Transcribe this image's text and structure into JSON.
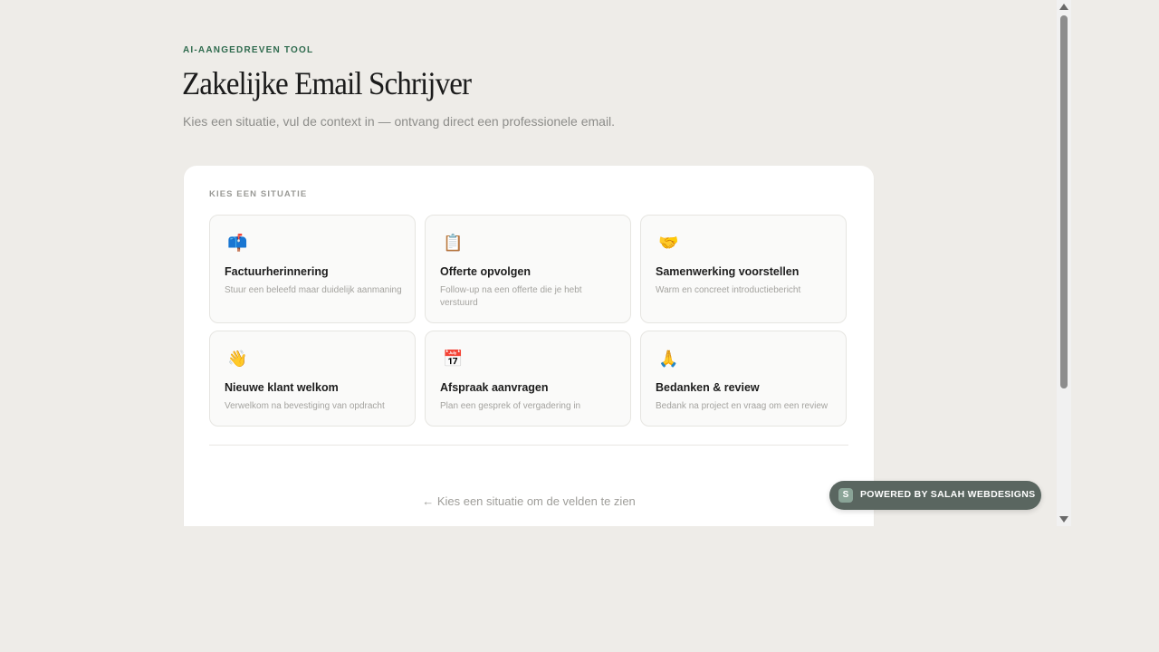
{
  "header": {
    "eyebrow": "AI-AANGEDREVEN TOOL",
    "title": "Zakelijke Email Schrijver",
    "subtitle": "Kies een situatie, vul de context in — ontvang direct een professionele email."
  },
  "panel": {
    "section_label": "KIES EEN SITUATIE",
    "situations": [
      {
        "icon": "mailbox-icon",
        "emoji": "📫",
        "title": "Factuurherinnering",
        "description": "Stuur een beleefd maar duidelijk aanmaning"
      },
      {
        "icon": "clipboard-icon",
        "emoji": "📋",
        "title": "Offerte opvolgen",
        "description": "Follow-up na een offerte die je hebt verstuurd"
      },
      {
        "icon": "handshake-icon",
        "emoji": "🤝",
        "title": "Samenwerking voorstellen",
        "description": "Warm en concreet introductiebericht"
      },
      {
        "icon": "waving-hand-icon",
        "emoji": "👋",
        "title": "Nieuwe klant welkom",
        "description": "Verwelkom na bevestiging van opdracht"
      },
      {
        "icon": "calendar-icon",
        "emoji": "📅",
        "title": "Afspraak aanvragen",
        "description": "Plan een gesprek of vergadering in"
      },
      {
        "icon": "folded-hands-icon",
        "emoji": "🙏",
        "title": "Bedanken & review",
        "description": "Bedank na project en vraag om een review"
      }
    ],
    "hint": "← Kies een situatie om de velden te zien"
  },
  "badge": {
    "icon_letter": "S",
    "text": "POWERED BY SALAH WEBDESIGNS"
  },
  "colors": {
    "page_background": "#eeece8",
    "accent_green": "#2f6b4e",
    "badge_background": "#5a6660"
  }
}
